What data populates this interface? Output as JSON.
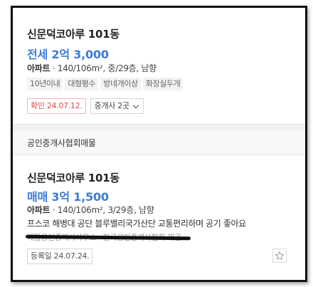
{
  "listing1": {
    "title": "신문덕코아루 101동",
    "price": "전세 2억 3,000",
    "info_type": "아파트",
    "info_detail": " · 140/106m², 중/29층, 남향",
    "tags": [
      "10년이내",
      "대형평수",
      "방네개이상",
      "화장실두개"
    ],
    "confirm_label": "확인 24.07.12.",
    "broker_label": "중개사 2곳"
  },
  "section": {
    "title": "공인중개사협회매물"
  },
  "listing2": {
    "title": "신문덕코아루 101동",
    "price": "매매 3억 1,500",
    "info_type": "아파트",
    "info_detail": " · 140/106m², 3/29층, 남향",
    "description": "프스코 해병대 공단 블루밸리국가산단 교통편리하며 공기 좋아요",
    "struck_text": "해뜰공인중개사사무소 · 한국공인중개사협회 제공",
    "register_label": "등록일 24.07.24."
  },
  "icons": {
    "favorite": "star-outline-icon",
    "dropdown": "chevron-down-icon"
  },
  "colors": {
    "price": "#3e7bd9",
    "confirm": "#e04b4f"
  }
}
